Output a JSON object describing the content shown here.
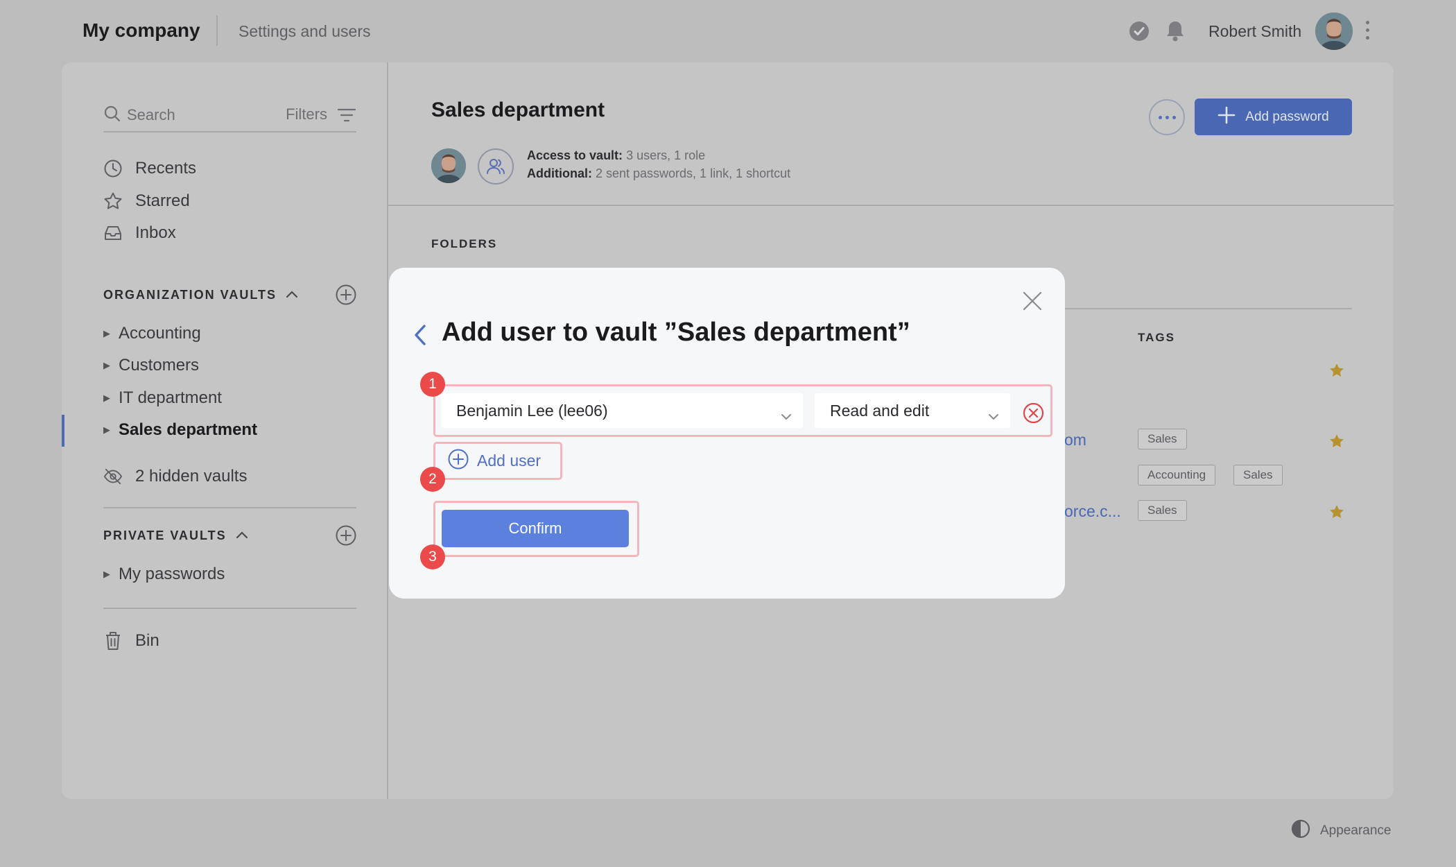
{
  "topbar": {
    "company": "My company",
    "settings": "Settings and users",
    "user_name": "Robert Smith"
  },
  "sidebar": {
    "search_placeholder": "Search",
    "filters": "Filters",
    "nav": [
      {
        "label": "Recents",
        "icon": "clock-icon"
      },
      {
        "label": "Starred",
        "icon": "star-outline-icon"
      },
      {
        "label": "Inbox",
        "icon": "inbox-icon"
      }
    ],
    "org_vaults_title": "ORGANIZATION VAULTS",
    "org_vaults": [
      {
        "label": "Accounting"
      },
      {
        "label": "Customers"
      },
      {
        "label": "IT department"
      },
      {
        "label": "Sales department",
        "active": true
      }
    ],
    "hidden_vaults": "2 hidden vaults",
    "private_vaults_title": "PRIVATE VAULTS",
    "private_vaults": [
      {
        "label": "My passwords"
      }
    ],
    "bin": "Bin"
  },
  "main": {
    "title": "Sales department",
    "access_label": "Access to vault:",
    "access_value": " 3 users, 1 role",
    "additional_label": "Additional:",
    "additional_value": " 2 sent passwords, 1 link, 1 shortcut",
    "add_password": "Add password",
    "folders_label": "FOLDERS",
    "tags_label": "TAGS",
    "link_fragments": [
      "om",
      "orce.c..."
    ],
    "tags": {
      "row1": [
        "Sales"
      ],
      "row2": [
        "Accounting",
        "Sales"
      ],
      "row3": [
        "Sales"
      ]
    }
  },
  "appearance": "Appearance",
  "modal": {
    "title": "Add user to vault ”Sales department”",
    "user_select_value": "Benjamin Lee (lee06)",
    "role_select_value": "Read and edit",
    "add_user": "Add user",
    "confirm": "Confirm",
    "badges": [
      "1",
      "2",
      "3"
    ]
  },
  "colors": {
    "accent": "#4a67b3",
    "confirm": "#5b80dd",
    "highlight": "#f3b6bd",
    "badge": "#ea4a4a",
    "star": "#c79a2b"
  }
}
